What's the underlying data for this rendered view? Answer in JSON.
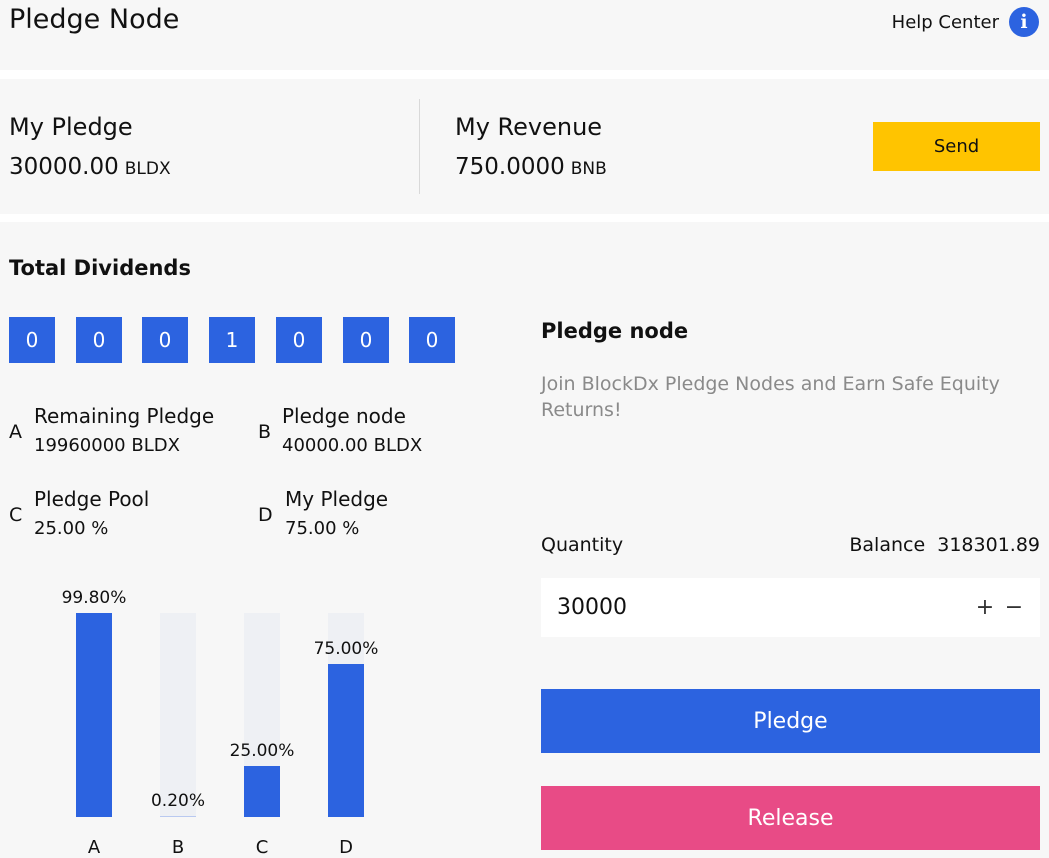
{
  "header": {
    "title": "Pledge Node",
    "help_label": "Help Center",
    "info_icon_glyph": "i"
  },
  "summary": {
    "my_pledge": {
      "label": "My Pledge",
      "value": "30000.00",
      "unit": "BLDX"
    },
    "my_revenue": {
      "label": "My Revenue",
      "value": "750.0000",
      "unit": "BNB"
    },
    "send_label": "Send"
  },
  "dividends": {
    "title": "Total Dividends",
    "digits": [
      "0",
      "0",
      "0",
      "1",
      "0",
      "0",
      "0"
    ]
  },
  "legend": [
    {
      "letter": "A",
      "name": "Remaining Pledge",
      "value": "19960000",
      "unit": "BLDX"
    },
    {
      "letter": "B",
      "name": "Pledge node",
      "value": "40000.00",
      "unit": "BLDX"
    },
    {
      "letter": "C",
      "name": "Pledge Pool",
      "value": "25.00",
      "unit": "%"
    },
    {
      "letter": "D",
      "name": "My Pledge",
      "value": "75.00",
      "unit": "%"
    }
  ],
  "chart_data": {
    "type": "bar",
    "categories": [
      "A",
      "B",
      "C",
      "D"
    ],
    "values": [
      99.8,
      0.2,
      25.0,
      75.0
    ],
    "data_labels": [
      "99.80%",
      "0.20%",
      "25.00%",
      "75.00%"
    ],
    "ylim": [
      0,
      100
    ],
    "grid": false
  },
  "pledge_panel": {
    "title": "Pledge node",
    "description": "Join BlockDx Pledge Nodes and Earn Safe Equity Returns!",
    "quantity_label": "Quantity",
    "balance_label": "Balance",
    "balance_value": "318301.89",
    "quantity_value": "30000",
    "plus_glyph": "+",
    "minus_glyph": "−",
    "pledge_label": "Pledge",
    "release_label": "Release"
  },
  "colors": {
    "accent_blue": "#2c63e0",
    "send_yellow": "#ffc400",
    "release_pink": "#e84b86",
    "bar_track": "#eef0f4"
  }
}
